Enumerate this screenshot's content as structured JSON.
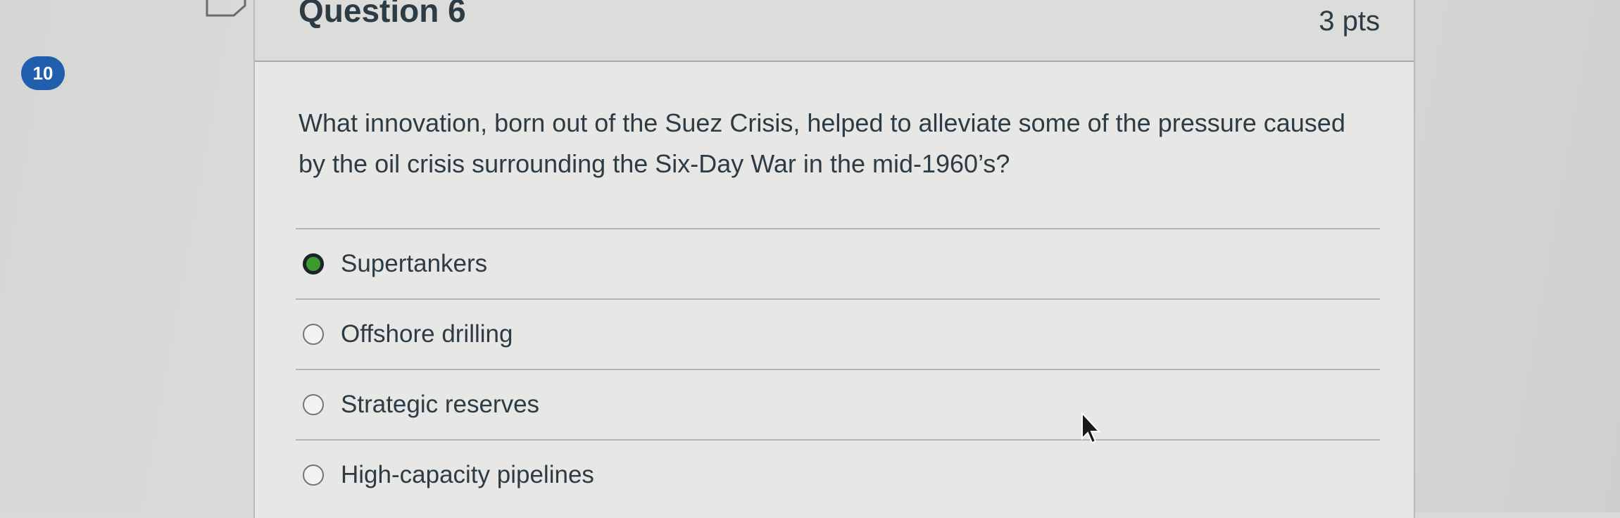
{
  "question": {
    "number_badge": "10",
    "title": "Question 6",
    "points": "3 pts",
    "text": "What innovation, born out of the Suez Crisis, helped to alleviate some of the pressure caused by the oil crisis surrounding the Six-Day War in the mid-1960’s?"
  },
  "answers": [
    {
      "label": "Supertankers",
      "selected": true
    },
    {
      "label": "Offshore drilling",
      "selected": false
    },
    {
      "label": "Strategic reserves",
      "selected": false
    },
    {
      "label": "High-capacity pipelines",
      "selected": false
    }
  ],
  "colors": {
    "badge": "#1f5fae",
    "selected_radio": "#3c9b2f",
    "text": "#2d3b45"
  },
  "icons": {
    "flag": "flag-icon",
    "cursor": "mouse-pointer-icon"
  }
}
